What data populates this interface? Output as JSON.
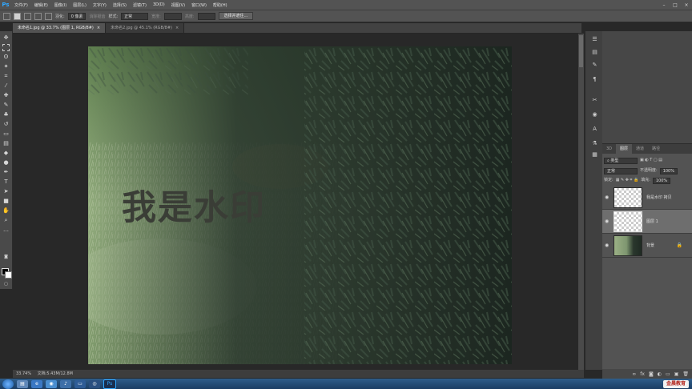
{
  "app": {
    "logo": "Ps",
    "menu": [
      "文件(F)",
      "编辑(E)",
      "图像(I)",
      "图层(L)",
      "文字(Y)",
      "选择(S)",
      "滤镜(T)",
      "3D(D)",
      "视图(V)",
      "窗口(W)",
      "帮助(H)"
    ],
    "window_controls": [
      "–",
      "□",
      "×"
    ]
  },
  "options_bar": {
    "feather_label": "羽化:",
    "feather_value": "0 像素",
    "antialias_label": "消除锯齿",
    "style_label": "样式:",
    "style_value": "正常",
    "width_label": "宽度:",
    "height_label": "高度:",
    "select_mask_button": "选择并遮住..."
  },
  "tabs": [
    {
      "label": "未命名1.jpg @ 33.7% (图层 1, RGB/8#)",
      "close": "×",
      "active": true
    },
    {
      "label": "未命名2.jpg @ 45.1% (RGB/8#)",
      "close": "×",
      "active": false
    }
  ],
  "canvas": {
    "watermark_text": "我是水印"
  },
  "status": {
    "zoom": "33.74%",
    "doc_info": "文档:5.43M/12.8M"
  },
  "layers_panel": {
    "tabs": [
      "3D",
      "图层",
      "通道",
      "路径"
    ],
    "filter_label": "类型",
    "blend_mode": "正常",
    "opacity_label": "不透明度:",
    "opacity_value": "100%",
    "lock_label": "锁定:",
    "fill_label": "填充:",
    "fill_value": "100%",
    "layers": [
      {
        "name": "我是水印 拷贝",
        "selected": false,
        "visible": true
      },
      {
        "name": "图层 1",
        "selected": true,
        "visible": true
      },
      {
        "name": "背景",
        "selected": false,
        "visible": true,
        "locked": true
      }
    ],
    "footer_icons": [
      "link-icon",
      "fx-icon",
      "mask-icon",
      "adjustment-icon",
      "folder-icon",
      "new-layer-icon",
      "trash-icon"
    ]
  },
  "taskbar": {
    "brand": "金晨教育"
  },
  "colors": {
    "ui_dark": "#535353",
    "accent_ps": "#31a8ff"
  }
}
